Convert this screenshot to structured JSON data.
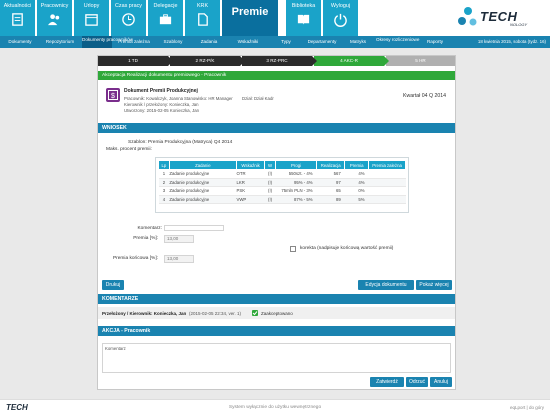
{
  "topnav": {
    "tiles": [
      {
        "label": "Aktualności",
        "icon": "notebook-icon"
      },
      {
        "label": "Pracownicy",
        "icon": "people-icon"
      },
      {
        "label": "Urlopy",
        "icon": "calendar-icon"
      },
      {
        "label": "Czas pracy",
        "icon": "clock-icon"
      },
      {
        "label": "Delegacje",
        "icon": "suitcase-icon"
      },
      {
        "label": "KRK",
        "icon": "document-icon"
      },
      {
        "label": "Premie",
        "icon": "bonus-icon"
      },
      {
        "label": "Biblioteka",
        "icon": "book-icon"
      },
      {
        "label": "Wyloguj",
        "icon": "power-icon"
      }
    ],
    "logo": {
      "brand": "TECH",
      "sub": "NOLOGY"
    }
  },
  "subnav": {
    "items": [
      "Dokumenty",
      "Repozytorium",
      "Dokumenty pracowników",
      "Premia zależna",
      "Szablony",
      "Zadania",
      "Wskaźniki",
      "Typy",
      "Departamenty",
      "Matryks",
      "Okresy rozliczeniowe",
      "Raporty"
    ],
    "datetime": "18 kwietnia 2015, sobota (tydz. 16)"
  },
  "steps": [
    "1 TD",
    "2 RZ-P/K",
    "3 RZ-PRC",
    "4 AKC-R",
    "5 HR"
  ],
  "document": {
    "subtitle": "Akceptacja Realizacji dokumentu premiowego - Pracownik",
    "title": "Dokument Premii Produkcyjnej",
    "employee": "Pracownik: Kowalczyk, Joanna",
    "position": "Stanowisko: HR Manager",
    "department": "Dział: Dział Kadr",
    "manager": "Kierownik / przełożony: Konieczka, Jan",
    "created": "Utworzony: 2015-02-05 Konieczka, Jan",
    "period": "Kwartał 04 Q 2014"
  },
  "wniosek": {
    "header": "WNIOSEK",
    "schema": "Szablon: Premia Produkcyjna (Matryca) Q4 2014",
    "max_pct": "Maks. procent premii:",
    "table": {
      "headers": [
        "Lp",
        "Zadanie",
        "Wskaźnik",
        "W",
        "Progi",
        "Realizacja",
        "Premia",
        "Premia zależna"
      ],
      "rows": [
        [
          "1",
          "Zadanie produkcyjne",
          "OTR",
          "(!)",
          "550szt. - 4%",
          "567",
          "4%",
          ""
        ],
        [
          "2",
          "Zadanie produkcyjne",
          "LKR",
          "(!)",
          "95% - 4%",
          "97",
          "4%",
          ""
        ],
        [
          "3",
          "Zadanie produkcyjne",
          "PSK",
          "(!)",
          "75mln PLN - 3%",
          "65",
          "0%",
          ""
        ],
        [
          "4",
          "Zadanie produkcyjne",
          "VWP",
          "(!)",
          "87% - 5%",
          "89",
          "5%",
          ""
        ]
      ]
    },
    "comment_label": "Komentarz:",
    "bonus_label": "Premia [%]:",
    "bonus_value": "13,00",
    "correction_label": "korekta (nadpisuje końcową wartość premii)",
    "final_label": "Premia końcowa [%]:",
    "final_value": "13,00"
  },
  "buttons": {
    "print": "Drukuj",
    "edit": "Edycja dokumentu",
    "more": "Pokaż więcej",
    "approve": "Zatwierdź",
    "reject": "Odrzuć",
    "cancel": "Anuluj"
  },
  "komentarze": {
    "header": "KOMENTARZE",
    "author": "Przełożony / Kierownik: Konieczka, Jan",
    "date": "(2015-02-05 22:34, ver. 1)",
    "status": "Zaakceptowano"
  },
  "akcja": {
    "header": "AKCJA - Pracownik",
    "comment_label": "Komentarz"
  },
  "footer": {
    "logo": "TECH",
    "center": "System wyłącznie do użytku wewnętrznego",
    "links": "eqLport  |  do góry"
  },
  "colors": {
    "accent": "#1aa3c9",
    "active": "#0a6f9e",
    "success": "#2fa83a",
    "section": "#1a83b0"
  }
}
